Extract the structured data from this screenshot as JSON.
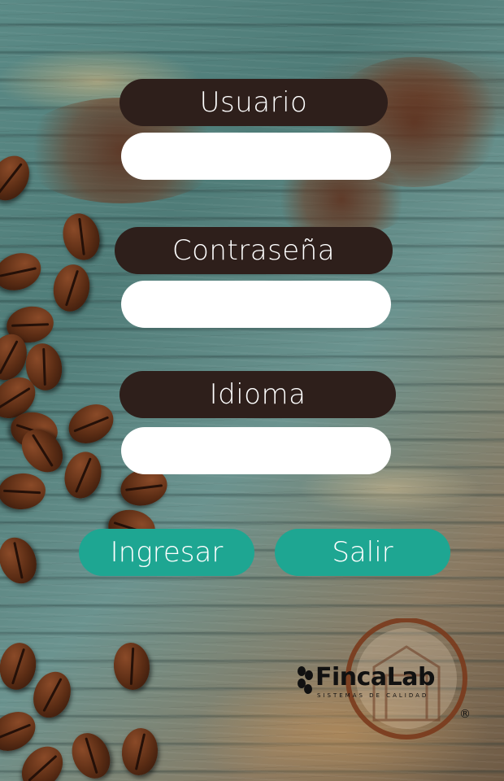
{
  "form": {
    "user_label": "Usuario",
    "user_value": "",
    "password_label": "Contraseña",
    "password_value": "",
    "language_label": "Idioma",
    "language_value": ""
  },
  "actions": {
    "login_label": "Ingresar",
    "exit_label": "Salir"
  },
  "brand": {
    "name": "FincaLab",
    "tagline": "SISTEMAS DE CALIDAD",
    "registered": "®"
  },
  "colors": {
    "label_bg": "#2e1f1b",
    "input_bg": "#ffffff",
    "button_bg": "#1ea692",
    "logo_ring": "#7a3a1c"
  },
  "icons": [
    "coffee-beans-icon",
    "house-icon"
  ]
}
